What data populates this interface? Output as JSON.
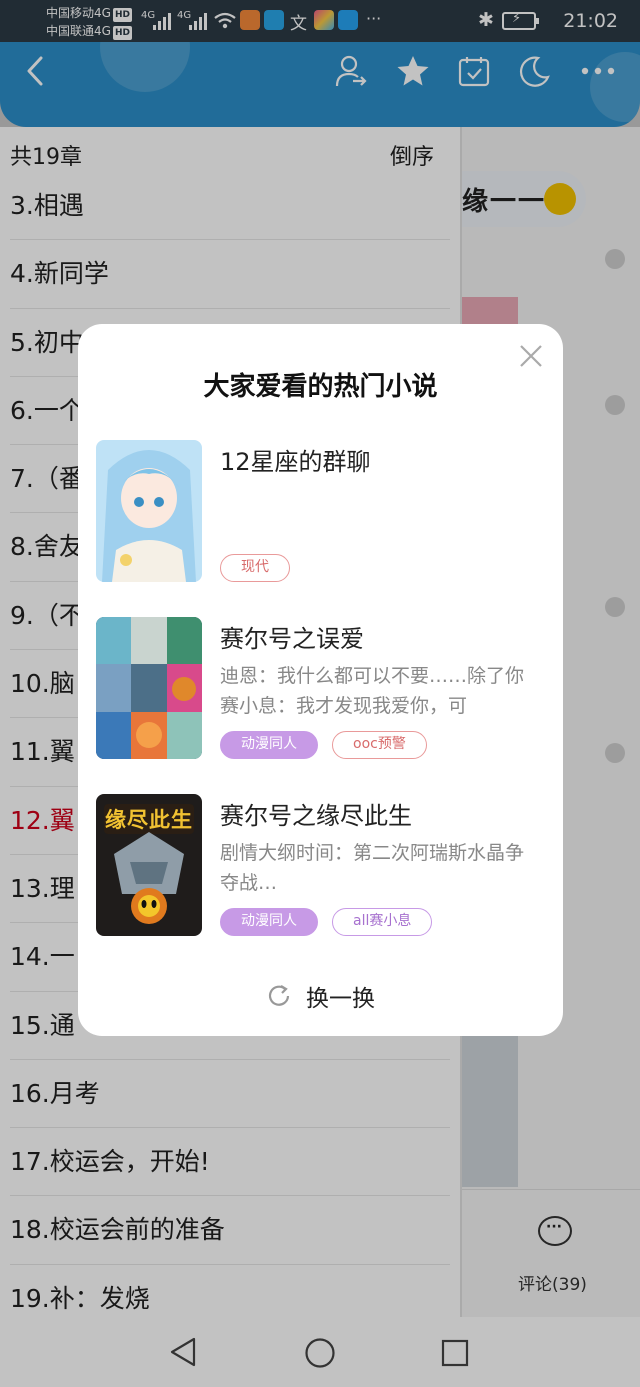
{
  "status_bar": {
    "carrier1": "中国移动4G",
    "carrier2": "中国联通4G",
    "hd_badge": "HD",
    "signal1": "4G",
    "signal2": "4G",
    "time": "21:02",
    "more_dots": "···"
  },
  "header": {
    "icons": [
      "back-icon",
      "share-author-icon",
      "star-icon",
      "calendar-check-icon",
      "moon-icon",
      "more-icon"
    ],
    "accent": "#2c8fc9"
  },
  "chapter_list": {
    "count_label": "共19章",
    "order_label": "倒序",
    "current_color": "#d0021b",
    "chapters": [
      "3.相遇",
      "4.新同学",
      "5.初中",
      "6.一个",
      "7.（番",
      "8.舍友",
      "9.（不",
      "10.脑",
      "11.翼",
      "12.翼",
      "13.理",
      "14.一",
      "15.通",
      "16.月考",
      "17.校运会，开始!",
      "18.校运会前的准备",
      "19.补：发烧"
    ],
    "current_index": 9
  },
  "reader_bg": {
    "banner_text": "缘一一",
    "comment_label": "评论(39)"
  },
  "modal": {
    "title": "大家爱看的热门小说",
    "books": [
      {
        "title": "12星座的群聊",
        "desc": "",
        "tags": [
          {
            "label": "现代",
            "style": "outline-red"
          }
        ]
      },
      {
        "title": "赛尔号之误爱",
        "desc": "迪恩：我什么都可以不要……除了你赛小息：我才发现我爱你，可",
        "tags": [
          {
            "label": "动漫同人",
            "style": "fill-purple"
          },
          {
            "label": "ooc预警",
            "style": "outline-red"
          }
        ]
      },
      {
        "title": "赛尔号之缘尽此生",
        "desc": "剧情大纲时间：第二次阿瑞斯水晶争夺战…",
        "cover_text": "缘尽此生",
        "tags": [
          {
            "label": "动漫同人",
            "style": "fill-purple"
          },
          {
            "label": "all赛小息",
            "style": "outline-purple"
          }
        ]
      }
    ],
    "refresh_label": "换一换"
  },
  "nav": {
    "icons": [
      "back-triangle-icon",
      "home-circle-icon",
      "recents-square-icon"
    ]
  }
}
